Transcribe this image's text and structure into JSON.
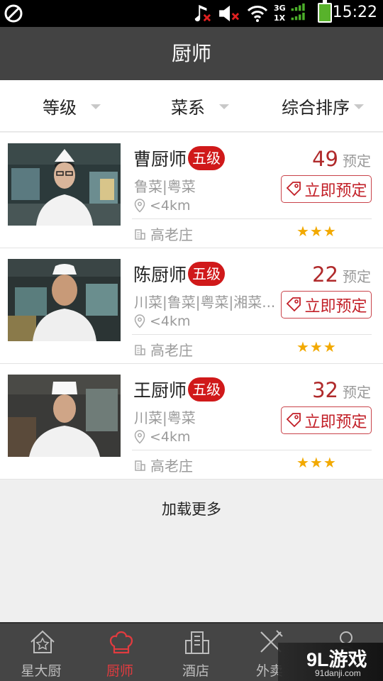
{
  "status_bar": {
    "time": "15:22",
    "network_top": "3G",
    "network_bottom": "1X",
    "icons": [
      "blocked-icon",
      "music-muted-icon",
      "volume-muted-icon",
      "wifi-icon",
      "signal-icon",
      "battery-icon"
    ]
  },
  "header": {
    "title": "厨师"
  },
  "filters": [
    {
      "label": "等级"
    },
    {
      "label": "菜系"
    },
    {
      "label": "综合排序"
    }
  ],
  "chefs": [
    {
      "name": "曹厨师",
      "level": "五级",
      "cuisine": "鲁菜|粤菜",
      "distance": "<4km",
      "location": "高老庄",
      "count": "49",
      "count_label": "预定",
      "book_label": "立即预定",
      "stars": "★★★",
      "rating": 3
    },
    {
      "name": "陈厨师",
      "level": "五级",
      "cuisine": "川菜|鲁菜|粤菜|湘菜...",
      "distance": "<4km",
      "location": "高老庄",
      "count": "22",
      "count_label": "预定",
      "book_label": "立即预定",
      "stars": "★★★",
      "rating": 3
    },
    {
      "name": "王厨师",
      "level": "五级",
      "cuisine": "川菜|粤菜",
      "distance": "<4km",
      "location": "高老庄",
      "count": "32",
      "count_label": "预定",
      "book_label": "立即预定",
      "stars": "★★★",
      "rating": 3
    }
  ],
  "load_more": "加载更多",
  "bottom_nav": [
    {
      "label": "星大厨",
      "icon": "house-star-icon",
      "active": false
    },
    {
      "label": "厨师",
      "icon": "chef-hat-icon",
      "active": true
    },
    {
      "label": "酒店",
      "icon": "building-icon",
      "active": false
    },
    {
      "label": "外卖",
      "icon": "fork-knife-icon",
      "active": false
    },
    {
      "label": "",
      "icon": "user-icon",
      "active": false
    }
  ],
  "watermark": {
    "logo": "9L游戏",
    "url": "91danji.com"
  },
  "colors": {
    "accent": "#d0191a",
    "header_bg": "#434343",
    "nav_bg": "#454545",
    "star": "#f2a900"
  }
}
